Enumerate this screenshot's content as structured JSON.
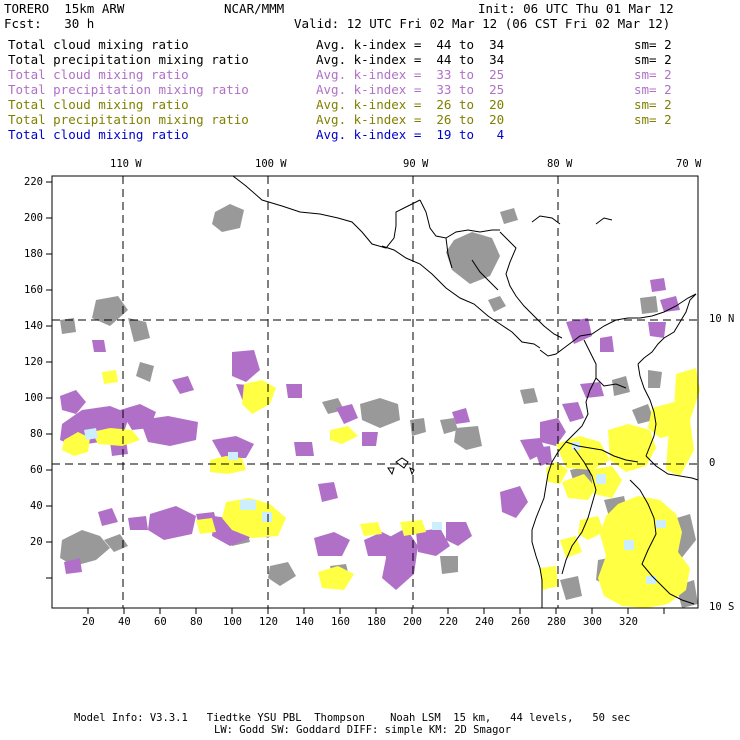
{
  "header": {
    "model": "TORERO  15km ARW",
    "org": "NCAR/MMM",
    "init": "Init: 06 UTC Thu 01 Mar 12",
    "fcst": "Fcst:   30 h",
    "valid": "Valid: 12 UTC Fri 02 Mar 12 (06 CST Fri 02 Mar 12)"
  },
  "fields": [
    {
      "name": "Total cloud mixing ratio",
      "kindex": "Avg. k-index =  44 to  34",
      "sm": "sm= 2",
      "color": "#000000"
    },
    {
      "name": "Total precipitation mixing ratio",
      "kindex": "Avg. k-index =  44 to  34",
      "sm": "sm= 2",
      "color": "#000000"
    },
    {
      "name": "Total cloud mixing ratio",
      "kindex": "Avg. k-index =  33 to  25",
      "sm": "sm= 2",
      "color": "#b070c8"
    },
    {
      "name": "Total precipitation mixing ratio",
      "kindex": "Avg. k-index =  33 to  25",
      "sm": "sm= 2",
      "color": "#b070c8"
    },
    {
      "name": "Total cloud mixing ratio",
      "kindex": "Avg. k-index =  26 to  20",
      "sm": "sm= 2",
      "color": "#808000"
    },
    {
      "name": "Total precipitation mixing ratio",
      "kindex": "Avg. k-index =  26 to  20",
      "sm": "sm= 2",
      "color": "#808000"
    },
    {
      "name": "Total cloud mixing ratio",
      "kindex": "Avg. k-index =  19 to   4",
      "sm": "",
      "color": "#0000cc"
    }
  ],
  "map": {
    "lon_labels": [
      "110 W",
      "100 W",
      "90 W",
      "80 W",
      "70 W"
    ],
    "lat_labels": [
      "10 N",
      "0",
      "10 S"
    ],
    "y_ticks": [
      "220",
      "200",
      "180",
      "160",
      "140",
      "120",
      "100",
      "80",
      "60",
      "40",
      "20"
    ],
    "x_ticks": [
      "20",
      "40",
      "60",
      "80",
      "100",
      "120",
      "140",
      "160",
      "180",
      "200",
      "220",
      "240",
      "260",
      "280",
      "300",
      "320"
    ],
    "colors": {
      "high_cloud": "#999999",
      "mid_cloud": "#b070c8",
      "low_cloud": "#ffff44",
      "lowest_cloud": "#cceeff"
    }
  },
  "footer": {
    "line1": "Model Info: V3.3.1   Tiedtke YSU PBL  Thompson    Noah LSM  15 km,   44 levels,   50 sec",
    "line2": "LW: Godd SW: Goddard DIFF: simple KM: 2D Smagor"
  }
}
